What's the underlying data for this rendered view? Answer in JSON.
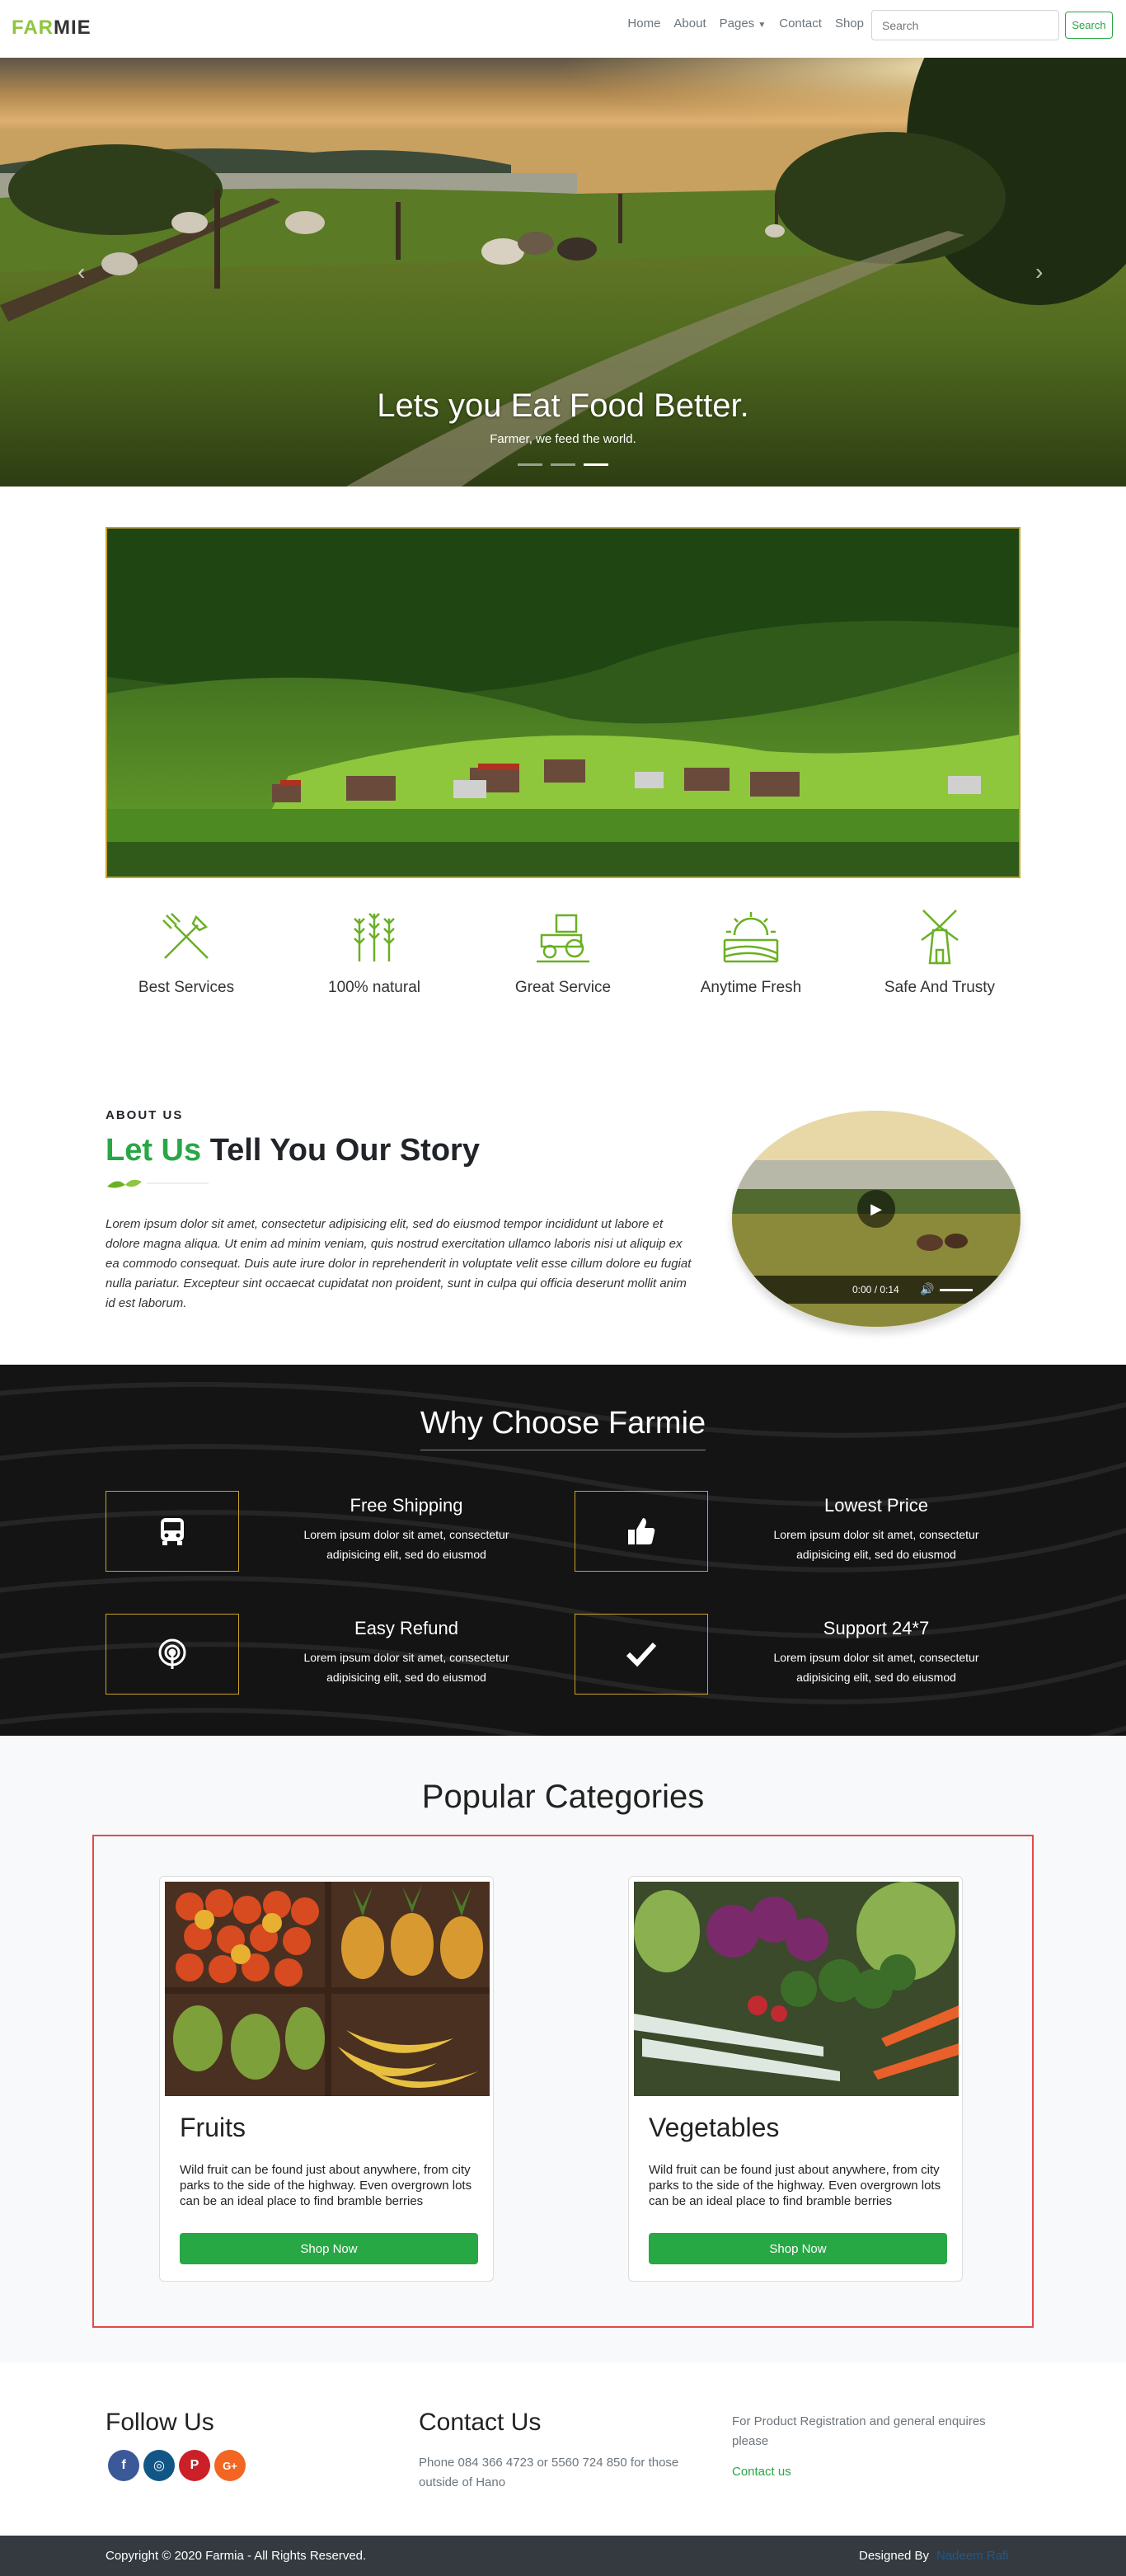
{
  "nav": {
    "brand_a": "FAR",
    "brand_b": "MIE",
    "links": [
      "Home",
      "About",
      "Pages",
      "Contact",
      "Shop"
    ],
    "search_placeholder": "Search",
    "search_button": "Search"
  },
  "hero": {
    "title": "Lets you Eat Food Better.",
    "subtitle": "Farmer, we feed the world.",
    "slides": 3,
    "active_slide": 3
  },
  "features": [
    {
      "label": "Best Services",
      "icon": "shovel-fork-icon"
    },
    {
      "label": "100% natural",
      "icon": "wheat-icon"
    },
    {
      "label": "Great Service",
      "icon": "tractor-icon"
    },
    {
      "label": "Anytime Fresh",
      "icon": "sunrise-field-icon"
    },
    {
      "label": "Safe And Trusty",
      "icon": "windmill-icon"
    }
  ],
  "about": {
    "kicker": "ABOUT US",
    "title_green": "Let Us",
    "title_rest": " Tell You Our Story",
    "text": "Lorem ipsum dolor sit amet, consectetur adipisicing elit, sed do eiusmod tempor incididunt ut labore et dolore magna aliqua. Ut enim ad minim veniam, quis nostrud exercitation ullamco laboris nisi ut aliquip ex ea commodo consequat. Duis aute irure dolor in reprehenderit in voluptate velit esse cillum dolore eu fugiat nulla pariatur. Excepteur sint occaecat cupidatat non proident, sunt in culpa qui officia deserunt mollit anim id est laborum.",
    "video_time": "0:00 / 0:14"
  },
  "why": {
    "title": "Why Choose Farmie",
    "items": [
      {
        "title": "Free Shipping",
        "text": "Lorem ipsum dolor sit amet, consectetur adipisicing elit, sed do eiusmod",
        "icon": "bus-icon"
      },
      {
        "title": "Lowest Price",
        "text": "Lorem ipsum dolor sit amet, consectetur adipisicing elit, sed do eiusmod",
        "icon": "thumbs-up-icon"
      },
      {
        "title": "Easy Refund",
        "text": "Lorem ipsum dolor sit amet, consectetur adipisicing elit, sed do eiusmod",
        "icon": "podcast-icon"
      },
      {
        "title": "Support 24*7",
        "text": "Lorem ipsum dolor sit amet, consectetur adipisicing elit, sed do eiusmod",
        "icon": "check-icon"
      }
    ]
  },
  "categories": {
    "title": "Popular Categories",
    "items": [
      {
        "name": "Fruits",
        "desc": "Wild fruit can be found just about anywhere, from city parks to the side of the highway. Even overgrown lots can be an ideal place to find bramble berries",
        "button": "Shop Now"
      },
      {
        "name": "Vegetables",
        "desc": "Wild fruit can be found just about anywhere, from city parks to the side of the highway. Even overgrown lots can be an ideal place to find bramble berries",
        "button": "Shop Now"
      }
    ]
  },
  "footer": {
    "follow_title": "Follow Us",
    "social": [
      {
        "name": "facebook-icon",
        "glyph": "f",
        "color": "#3b5998"
      },
      {
        "name": "instagram-icon",
        "glyph": "◎",
        "color": "#125688"
      },
      {
        "name": "pinterest-icon",
        "glyph": "P",
        "color": "#cb2027"
      },
      {
        "name": "google-plus-icon",
        "glyph": "G+",
        "color": "#f26522"
      }
    ],
    "contact_title": "Contact Us",
    "contact_text": "Phone 084 366 4723 or 5560 724 850 for those outside of Hano",
    "enquiry_text": "For Product Registration and general enquires please",
    "contact_link": "Contact us"
  },
  "copyright": {
    "text": "Copyright © 2020 Farmia - All Rights Reserved.",
    "designed_by": "Designed By",
    "designer": "Nadeem Rafi"
  },
  "colors": {
    "accent": "#28a745",
    "brand_green": "#8dc63f",
    "gold": "#c9a227",
    "dark": "#343a40"
  }
}
